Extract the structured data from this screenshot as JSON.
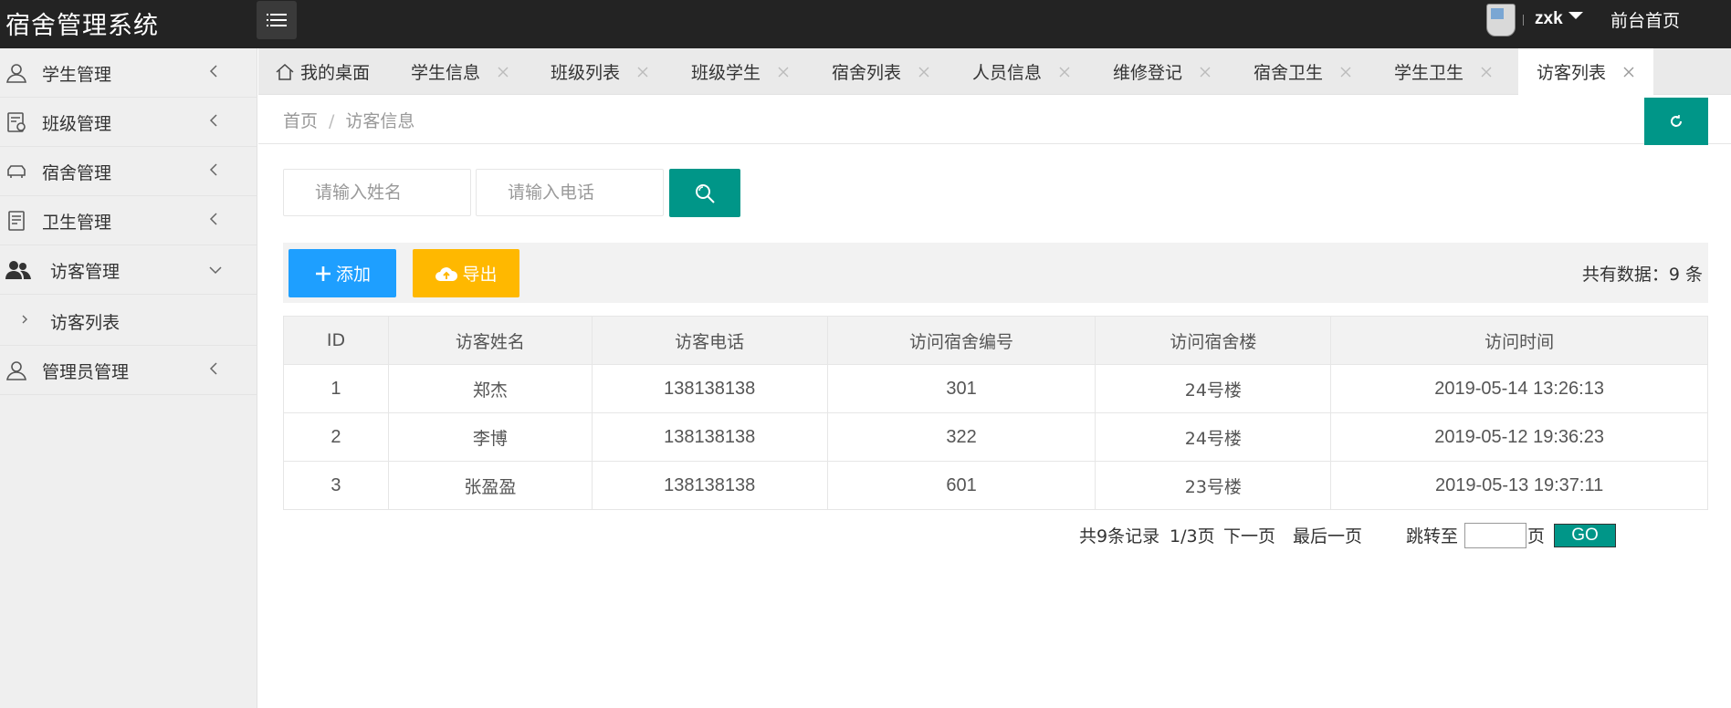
{
  "app": {
    "title": "宿舍管理系统"
  },
  "topbar": {
    "menu_icon": "list-icon",
    "username": "zxk",
    "front_home": "前台首页"
  },
  "sidebar": {
    "items": [
      {
        "label": "学生管理",
        "icon": "user-icon"
      },
      {
        "label": "班级管理",
        "icon": "class-icon"
      },
      {
        "label": "宿舍管理",
        "icon": "sofa-icon"
      },
      {
        "label": "卫生管理",
        "icon": "document-icon"
      },
      {
        "label": "访客管理",
        "icon": "users-icon",
        "expanded": true
      },
      {
        "label": "管理员管理",
        "icon": "user-icon"
      }
    ],
    "sub_items": [
      {
        "label": "访客列表"
      }
    ]
  },
  "tabs": [
    {
      "label": "我的桌面"
    },
    {
      "label": "学生信息"
    },
    {
      "label": "班级列表"
    },
    {
      "label": "班级学生"
    },
    {
      "label": "宿舍列表"
    },
    {
      "label": "人员信息"
    },
    {
      "label": "维修登记"
    },
    {
      "label": "宿舍卫生"
    },
    {
      "label": "学生卫生"
    },
    {
      "label": "访客列表",
      "active": true
    }
  ],
  "breadcrumb": {
    "home": "首页",
    "separator": "/",
    "current": "访客信息"
  },
  "search": {
    "name_placeholder": "请输入姓名",
    "phone_placeholder": "请输入电话"
  },
  "toolbar": {
    "add_label": "添加",
    "export_label": "导出",
    "total_text": "共有数据：9 条"
  },
  "table": {
    "headers": [
      "ID",
      "访客姓名",
      "访客电话",
      "访问宿舍编号",
      "访问宿舍楼",
      "访问时间"
    ],
    "rows": [
      [
        "1",
        "郑杰",
        "138138138",
        "301",
        "24号楼",
        "2019-05-14 13:26:13"
      ],
      [
        "2",
        "李博",
        "138138138",
        "322",
        "24号楼",
        "2019-05-12 19:36:23"
      ],
      [
        "3",
        "张盈盈",
        "138138138",
        "601",
        "23号楼",
        "2019-05-13 19:37:11"
      ]
    ]
  },
  "pager": {
    "records": "共9条记录",
    "page": "1/3页",
    "next": "下一页",
    "last": "最后一页",
    "jump_label": "跳转至",
    "page_suffix": "页",
    "go": "GO"
  },
  "colors": {
    "primary": "#009688",
    "blue": "#1e9fff",
    "orange": "#ffb800",
    "topbar": "#232323"
  }
}
